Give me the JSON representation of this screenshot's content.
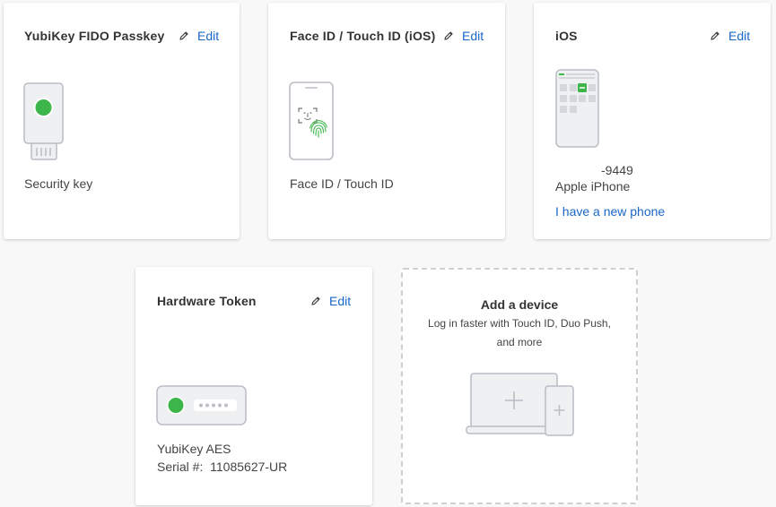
{
  "cards": {
    "yubikey": {
      "title": "YubiKey FIDO Passkey",
      "edit_label": "Edit",
      "device_label": "Security key"
    },
    "faceid": {
      "title": "Face ID / Touch ID (iOS)",
      "edit_label": "Edit",
      "device_label": "Face ID / Touch ID"
    },
    "ios": {
      "title": "iOS",
      "edit_label": "Edit",
      "phone_number": "-9449",
      "device_label": "Apple iPhone",
      "new_phone_link": "I have a new phone"
    },
    "hardware_token": {
      "title": "Hardware Token",
      "edit_label": "Edit",
      "device_label": "YubiKey AES",
      "serial": "Serial #:  11085627-UR"
    },
    "add_device": {
      "title": "Add a device",
      "subtitle": "Log in faster with Touch ID, Duo Push, and more"
    }
  },
  "colors": {
    "link": "#1a67c9",
    "status_green": "#3cb64a",
    "device_fill": "#eef0f2",
    "device_stroke": "#b9bec4"
  }
}
